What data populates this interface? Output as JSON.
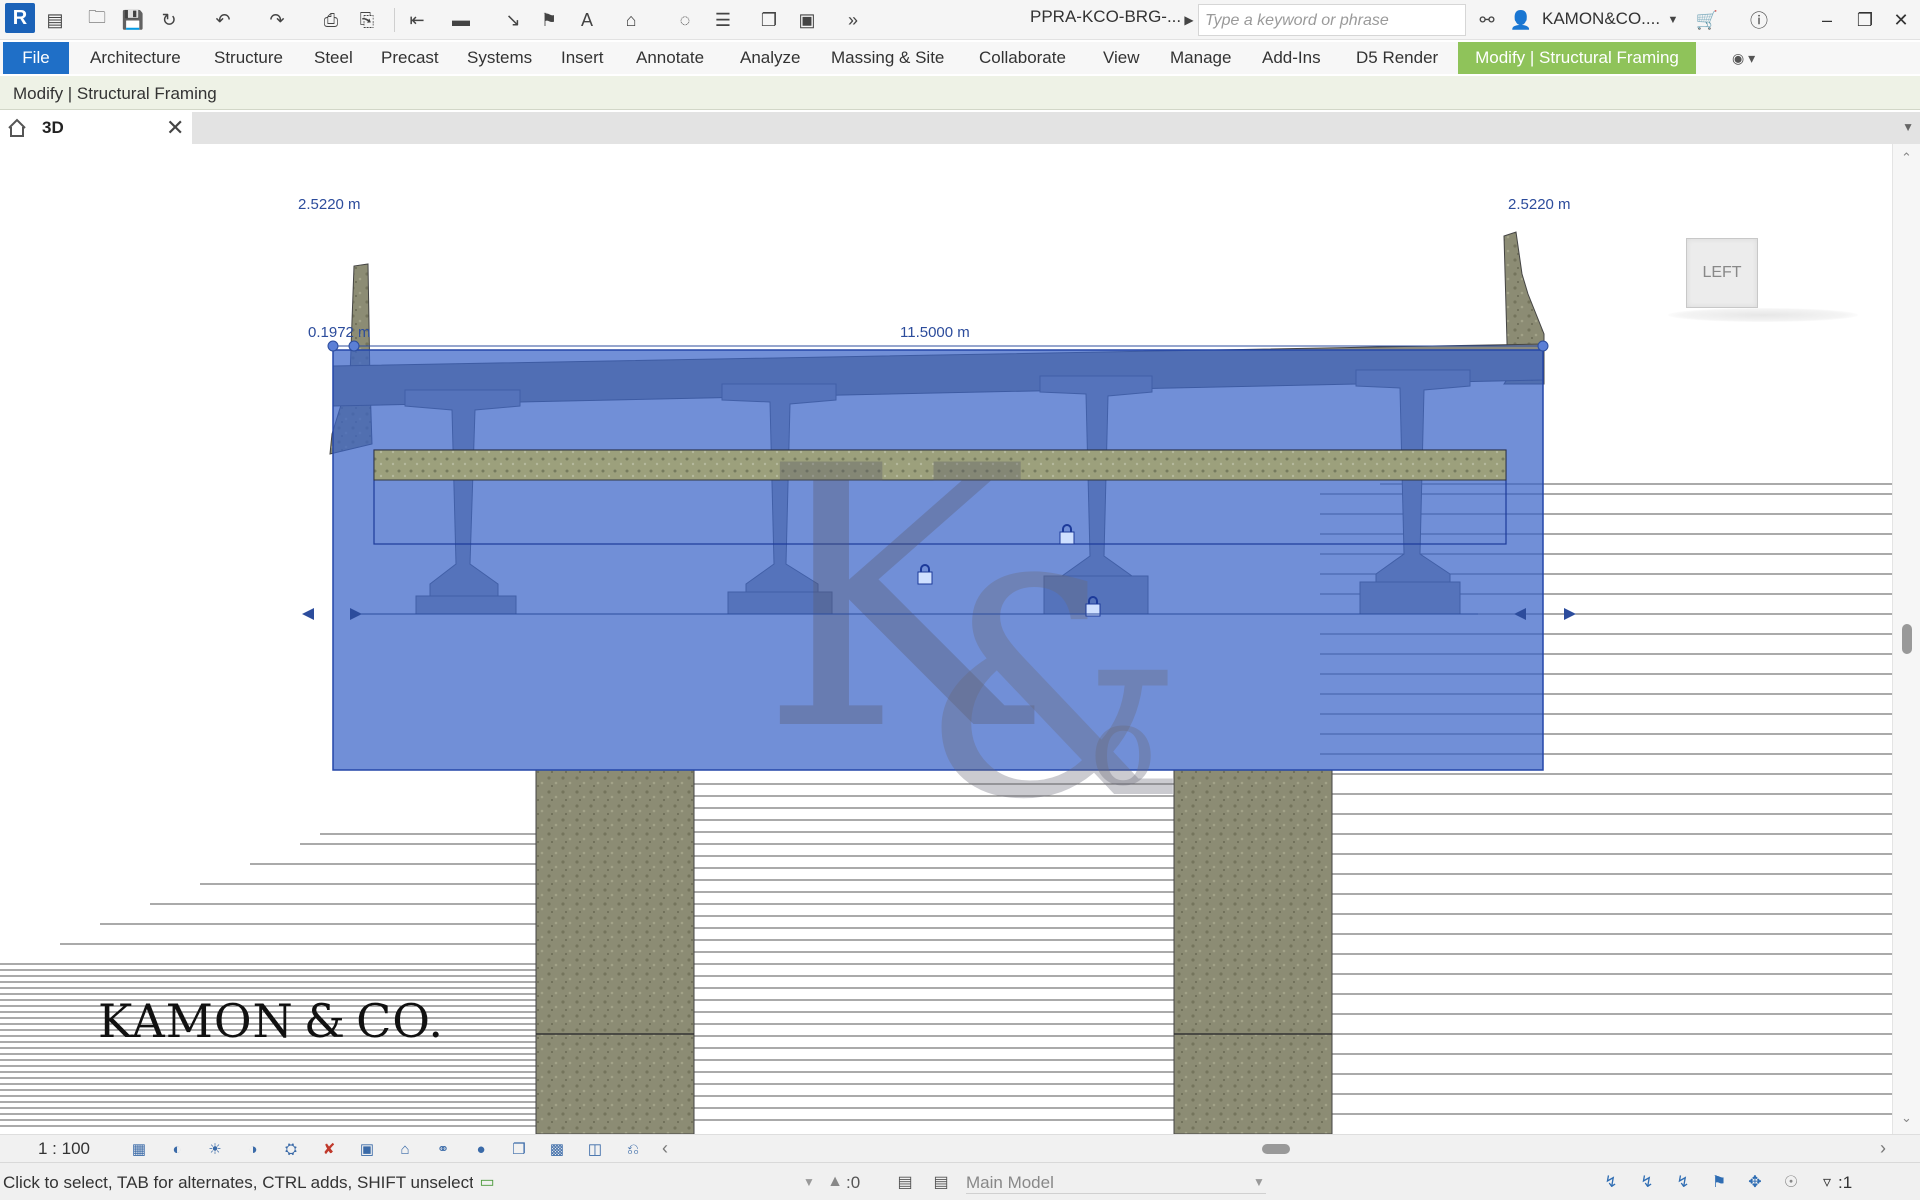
{
  "app": {
    "logo_letter": "R",
    "document_title": "PPRA-KCO-BRG-...",
    "search_placeholder": "Type a keyword or phrase",
    "user_name": "KAMON&CO...."
  },
  "ribbon": {
    "tabs": [
      "File",
      "Architecture",
      "Structure",
      "Steel",
      "Precast",
      "Systems",
      "Insert",
      "Annotate",
      "Analyze",
      "Massing & Site",
      "Collaborate",
      "View",
      "Manage",
      "Add-Ins",
      "D5 Render",
      "Modify | Structural Framing"
    ],
    "active_tab": "Modify | Structural Framing",
    "accent_color": "#8fc35a",
    "file_color": "#1f6fc7"
  },
  "context_bar": {
    "label": "Modify | Structural Framing"
  },
  "view_tab": {
    "label": "3D"
  },
  "canvas": {
    "dimensions": {
      "left_top": "2.5220 m",
      "right_top": "2.5220 m",
      "left_offset": "0.1972 m",
      "span": "11.5000 m"
    },
    "viewcube_label": "LEFT",
    "brand_text": "KAMON & CO.",
    "watermark_text": "K&Co",
    "selection_color": "#3a64c8"
  },
  "view_control_bar": {
    "scale": "1 : 100"
  },
  "status_bar": {
    "message": "Click to select, TAB for alternates, CTRL adds, SHIFT unselect",
    "selection_count": ":0",
    "model": "Main Model",
    "filter_count": ":1"
  }
}
